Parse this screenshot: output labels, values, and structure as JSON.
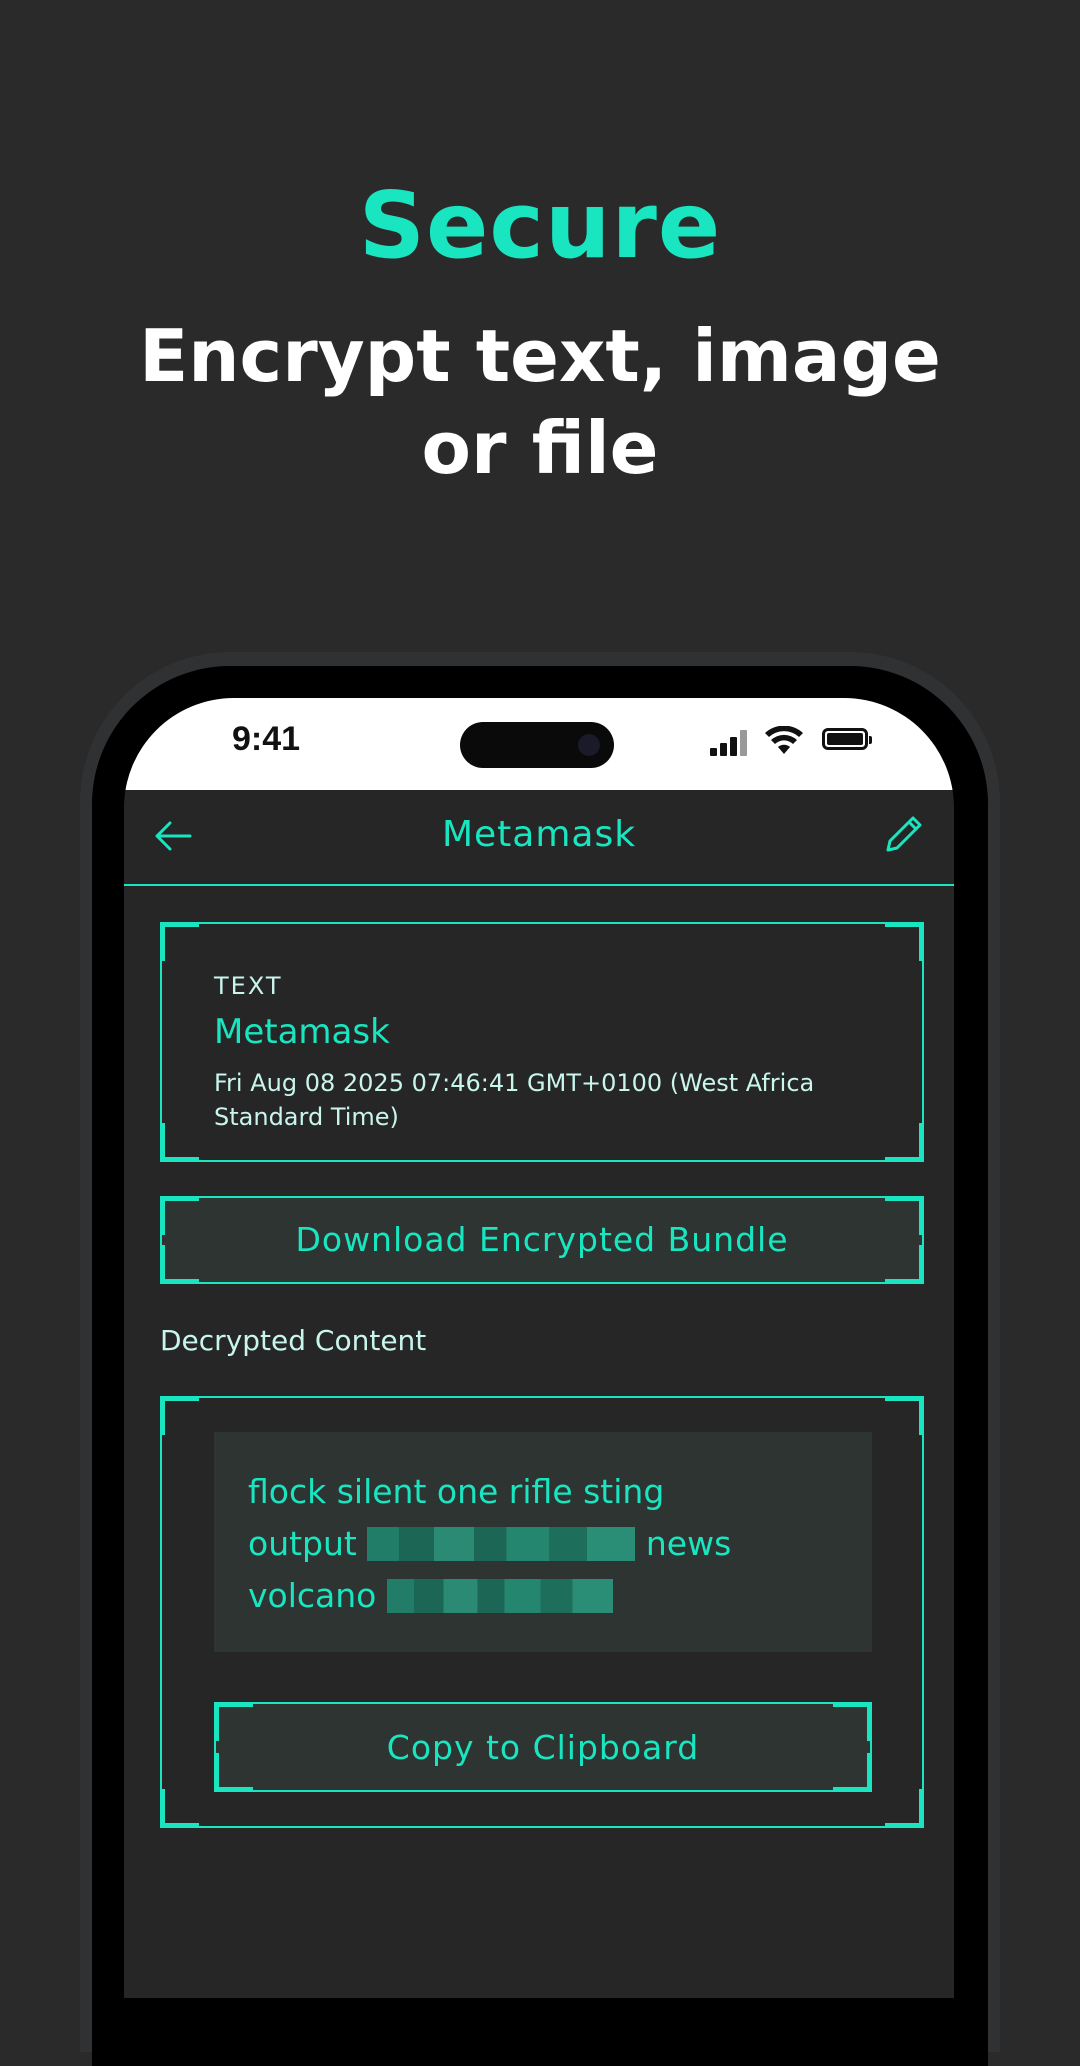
{
  "promo": {
    "headline": "Secure",
    "subheadline": "Encrypt text, image or file"
  },
  "status_bar": {
    "time": "9:41"
  },
  "app_bar": {
    "title": "Metamask",
    "back_icon": "arrow-left-icon",
    "edit_icon": "pencil-icon"
  },
  "entry": {
    "type": "TEXT",
    "name": "Metamask",
    "date": "Fri Aug 08 2025 07:46:41 GMT+0100 (West Africa Standard Time)"
  },
  "actions": {
    "download_label": "Download Encrypted Bundle",
    "copy_label": "Copy to Clipboard"
  },
  "decrypted": {
    "section_label": "Decrypted Content",
    "words_line1": "flock silent one rifle sting",
    "words_line2_start": "output",
    "words_line2_end": "news",
    "words_line3_start": "volcano"
  },
  "colors": {
    "accent": "#19e6c1",
    "background": "#2a2a2a",
    "screen": "#262626",
    "card_fill": "#2d3431"
  }
}
